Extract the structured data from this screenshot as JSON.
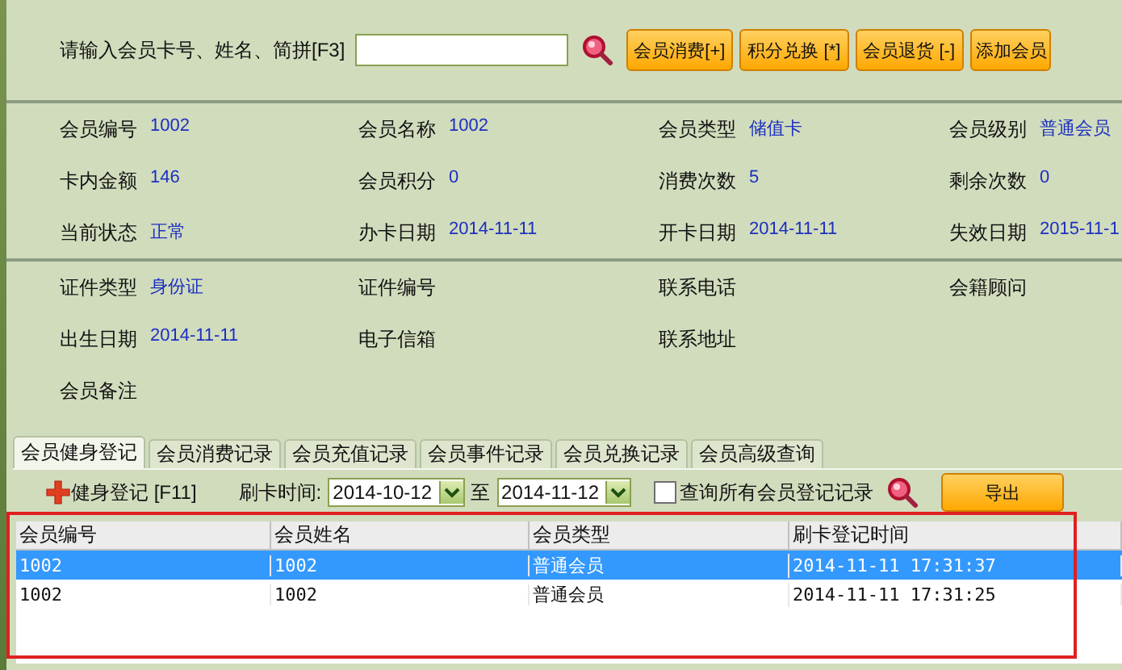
{
  "search": {
    "label": "请输入会员卡号、姓名、简拼[F3]",
    "buttons": [
      "会员消费[+]",
      "积分兑换 [*]",
      "会员退货 [-]",
      "添加会员"
    ]
  },
  "member_info": [
    [
      {
        "label": "会员编号",
        "value": "1002"
      },
      {
        "label": "会员名称",
        "value": "1002"
      },
      {
        "label": "会员类型",
        "value": "储值卡"
      },
      {
        "label": "会员级别",
        "value": "普通会员"
      }
    ],
    [
      {
        "label": "卡内金额",
        "value": "146"
      },
      {
        "label": "会员积分",
        "value": "0"
      },
      {
        "label": "消费次数",
        "value": "5"
      },
      {
        "label": "剩余次数",
        "value": "0"
      }
    ],
    [
      {
        "label": "当前状态",
        "value": "正常"
      },
      {
        "label": "办卡日期",
        "value": "2014-11-11"
      },
      {
        "label": "开卡日期",
        "value": "2014-11-11"
      },
      {
        "label": "失效日期",
        "value": "2015-11-1"
      }
    ]
  ],
  "personal_info": [
    [
      {
        "label": "证件类型",
        "value": "身份证"
      },
      {
        "label": "证件编号"
      },
      {
        "label": "联系电话"
      },
      {
        "label": "会籍顾问"
      }
    ],
    [
      {
        "label": "出生日期",
        "value": "2014-11-11"
      },
      {
        "label": "电子信箱"
      },
      {
        "label": "联系地址"
      }
    ],
    [
      {
        "label": "会员备注"
      }
    ]
  ],
  "tabs": [
    {
      "label": "会员健身登记",
      "selected": true
    },
    {
      "label": "会员消费记录",
      "selected": false
    },
    {
      "label": "会员充值记录",
      "selected": false
    },
    {
      "label": "会员事件记录",
      "selected": false
    },
    {
      "label": "会员兑换记录",
      "selected": false
    },
    {
      "label": "会员高级查询",
      "selected": false
    }
  ],
  "toolbar": {
    "add_button": "健身登记 [F11]",
    "date_label": "刷卡时间:",
    "date_from": "2014-10-12",
    "range_separator": "至",
    "date_to": "2014-11-12",
    "all_members_checkbox": {
      "label": "查询所有会员登记记录",
      "checked": false
    },
    "export_button": "导出"
  },
  "table": {
    "columns": [
      "会员编号",
      "会员姓名",
      "会员类型",
      "刷卡登记时间"
    ],
    "rows": [
      {
        "cells": [
          "1002",
          "1002",
          "普通会员",
          "2014-11-11 17:31:37"
        ],
        "selected": true
      },
      {
        "cells": [
          "1002",
          "1002",
          "普通会员",
          "2014-11-11 17:31:25"
        ],
        "selected": false
      }
    ]
  }
}
